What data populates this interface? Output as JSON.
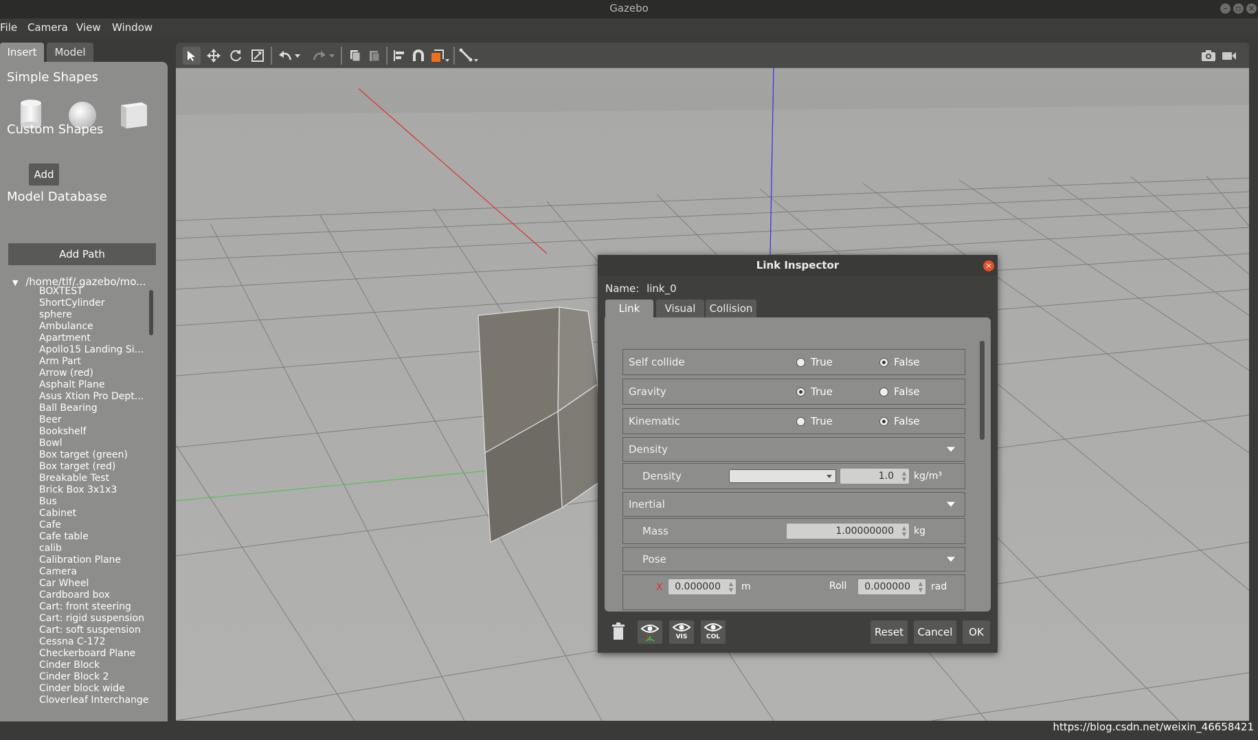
{
  "window": {
    "title": "Gazebo"
  },
  "menu": {
    "file": "File",
    "camera": "Camera",
    "view": "View",
    "window": "Window"
  },
  "left_panel": {
    "tabs": [
      "Insert",
      "Model"
    ],
    "simple_shapes_heading": "Simple Shapes",
    "custom_shapes_heading": "Custom Shapes",
    "add_button": "Add",
    "model_database_heading": "Model Database",
    "add_path_button": "Add Path",
    "db_path": "/home/tlf/.gazebo/mo...",
    "models": [
      "BOXTEST",
      "ShortCylinder",
      "sphere",
      "Ambulance",
      "Apartment",
      "Apollo15 Landing Si...",
      "Arm Part",
      "Arrow (red)",
      "Asphalt Plane",
      "Asus Xtion Pro Dept...",
      "Ball Bearing",
      "Beer",
      "Bookshelf",
      "Bowl",
      "Box target (green)",
      "Box target (red)",
      "Breakable Test",
      "Brick Box 3x1x3",
      "Bus",
      "Cabinet",
      "Cafe",
      "Cafe table",
      "calib",
      "Calibration Plane",
      "Camera",
      "Car Wheel",
      "Cardboard box",
      "Cart: front steering",
      "Cart: rigid suspension",
      "Cart: soft suspension",
      "Cessna C-172",
      "Checkerboard Plane",
      "Cinder Block",
      "Cinder Block 2",
      "Cinder block wide",
      "Cloverleaf Interchange"
    ]
  },
  "toolbar": {
    "icons": [
      "select-arrow-icon",
      "translate-icon",
      "rotate-icon",
      "scale-icon",
      "undo-icon",
      "undo-dropdown-icon",
      "redo-icon",
      "redo-dropdown-icon",
      "copy-icon",
      "paste-icon",
      "align-icon",
      "snap-magnet-icon",
      "view-angle-icon",
      "joint-link-icon",
      "screenshot-camera-icon",
      "record-video-icon"
    ]
  },
  "dialog": {
    "title": "Link Inspector",
    "name_label": "Name:",
    "name_value": "link_0",
    "tabs": [
      "Link",
      "Visual",
      "Collision"
    ],
    "true_label": "True",
    "false_label": "False",
    "self_collide": {
      "label": "Self collide",
      "value": "False"
    },
    "gravity": {
      "label": "Gravity",
      "value": "True"
    },
    "kinematic": {
      "label": "Kinematic",
      "value": "False"
    },
    "density_section": "Density",
    "density": {
      "label": "Density",
      "value": "1.0",
      "unit": "kg/m³"
    },
    "inertial_section": "Inertial",
    "mass": {
      "label": "Mass",
      "value": "1.00000000",
      "unit": "kg"
    },
    "pose_section": "Pose",
    "pose_x": {
      "axis": "X",
      "value": "0.000000",
      "unit": "m"
    },
    "pose_roll": {
      "label": "Roll",
      "value": "0.000000",
      "unit": "rad"
    },
    "footer": {
      "vis_label": "VIS",
      "col_label": "COL",
      "reset": "Reset",
      "cancel": "Cancel",
      "ok": "OK"
    }
  },
  "watermark": "https://blog.csdn.net/weixin_46658421"
}
